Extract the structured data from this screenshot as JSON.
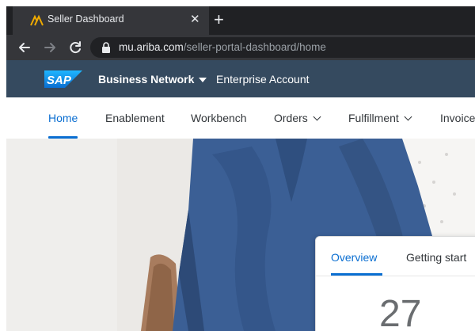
{
  "browser": {
    "tab": {
      "title": "Seller Dashboard",
      "close_glyph": "✕",
      "favicon": "ariba-chevron-icon"
    },
    "new_tab_glyph": "+",
    "url": {
      "host": "mu.ariba.com",
      "path": "/seller-portal-dashboard/home"
    }
  },
  "shellbar": {
    "logo_text": "SAP",
    "title": "Business Network",
    "account": "Enterprise Account"
  },
  "nav": {
    "items": [
      {
        "label": "Home",
        "active": true,
        "dropdown": false
      },
      {
        "label": "Enablement",
        "active": false,
        "dropdown": false
      },
      {
        "label": "Workbench",
        "active": false,
        "dropdown": false
      },
      {
        "label": "Orders",
        "active": false,
        "dropdown": true
      },
      {
        "label": "Fulfillment",
        "active": false,
        "dropdown": true
      },
      {
        "label": "Invoice",
        "active": false,
        "dropdown": false
      }
    ]
  },
  "card": {
    "tabs": [
      {
        "label": "Overview",
        "active": true
      },
      {
        "label": "Getting start",
        "active": false
      }
    ],
    "count": "27"
  },
  "colors": {
    "shellbar": "#354a5f",
    "accent": "#0a6ed1",
    "chrome_dark": "#202124",
    "chrome_tab": "#35363a"
  }
}
